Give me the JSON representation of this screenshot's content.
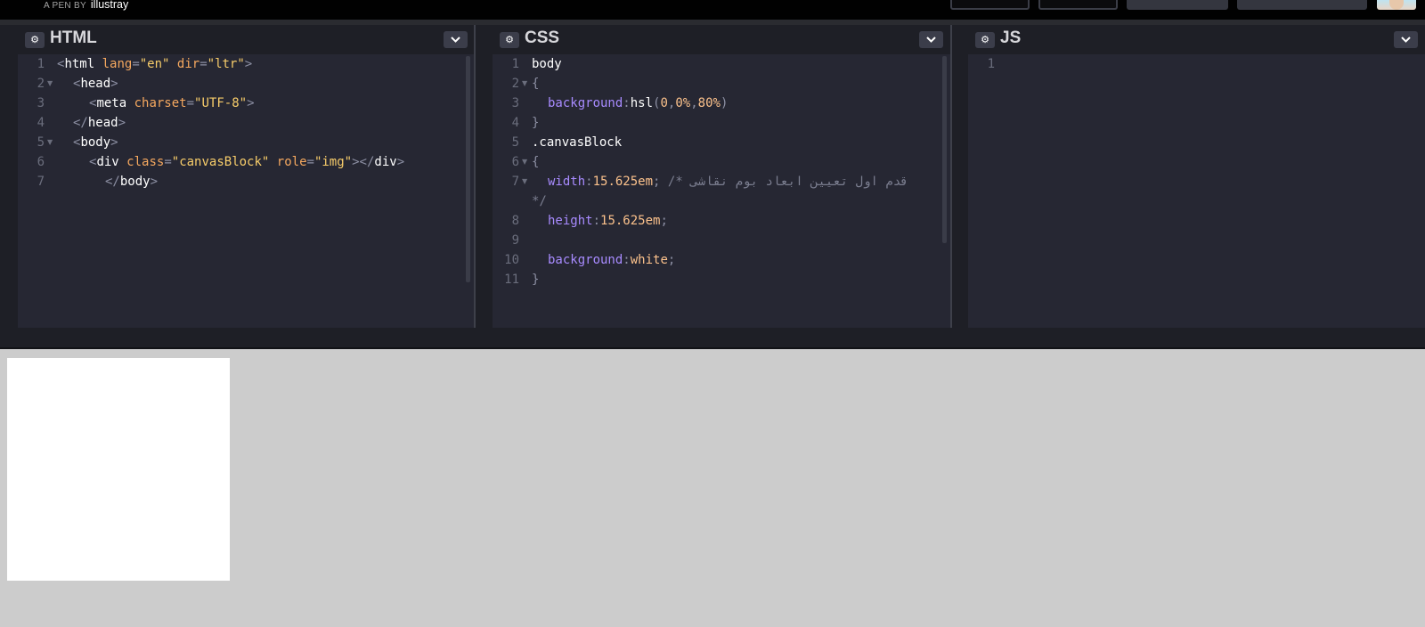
{
  "topbar": {
    "pen_by_prefix": "A PEN BY",
    "author": "illustray"
  },
  "editors": [
    {
      "title": "HTML",
      "lines": [
        {
          "num": "1",
          "fold": false
        },
        {
          "num": "2",
          "fold": true
        },
        {
          "num": "3",
          "fold": false
        },
        {
          "num": "4",
          "fold": false
        },
        {
          "num": "5",
          "fold": true
        },
        {
          "num": "6",
          "fold": false
        },
        {
          "num": "7",
          "fold": false
        }
      ],
      "code": {
        "l1": {
          "lt": "<",
          "tag": "html",
          "attr1": "lang",
          "eq1": "=",
          "val1": "\"en\"",
          "attr2": "dir",
          "eq2": "=",
          "val2": "\"ltr\"",
          "gt": ">"
        },
        "l2": {
          "lt": "<",
          "tag": "head",
          "gt": ">"
        },
        "l3": {
          "lt": "<",
          "tag": "meta",
          "attr": "charset",
          "eq": "=",
          "val": "\"UTF-8\"",
          "gt": ">"
        },
        "l4": {
          "lt": "</",
          "tag": "head",
          "gt": ">"
        },
        "l5": {
          "lt": "<",
          "tag": "body",
          "gt": ">"
        },
        "l6": {
          "lt": "<",
          "tag": "div",
          "attr1": "class",
          "eq1": "=",
          "val1": "\"canvasBlock\"",
          "attr2": "role",
          "eq2": "=",
          "val2": "\"img\"",
          "gt": ">",
          "close_lt": "</",
          "close_tag": "div",
          "close_gt": ">"
        },
        "l7": {
          "lt": "</",
          "tag": "body",
          "gt": ">"
        }
      }
    },
    {
      "title": "CSS",
      "lines": [
        {
          "num": "1",
          "fold": false
        },
        {
          "num": "2",
          "fold": true
        },
        {
          "num": "3",
          "fold": false
        },
        {
          "num": "4",
          "fold": false
        },
        {
          "num": "5",
          "fold": false
        },
        {
          "num": "6",
          "fold": true
        },
        {
          "num": "7",
          "fold": true
        },
        {
          "num": "8",
          "fold": false
        },
        {
          "num": "9",
          "fold": false
        },
        {
          "num": "10",
          "fold": false
        },
        {
          "num": "11",
          "fold": false
        }
      ],
      "code": {
        "l1": "body",
        "l2": "{",
        "l3": {
          "prop": "background",
          "colon": ":",
          "fn": "hsl",
          "open": "(",
          "a": "0",
          "c1": ",",
          "b": "0%",
          "c2": ",",
          "c": "80%",
          "close": ")"
        },
        "l4": "}",
        "l5": ".canvasBlock",
        "l6": "{",
        "l7": {
          "prop": "width",
          "colon": ":",
          "value": "15.625em",
          "semi": ";",
          "comment": "/* قدم اول تعیین ابعاد بوم نقاشی",
          "comment_end": "*/"
        },
        "l8": {
          "prop": "height",
          "colon": ":",
          "value": "15.625em",
          "semi": ";"
        },
        "l10": {
          "prop": "background",
          "colon": ":",
          "value": "white",
          "semi": ";"
        },
        "l11": "}"
      }
    },
    {
      "title": "JS",
      "lines": [
        {
          "num": "1",
          "fold": false
        }
      ]
    }
  ],
  "colors": {
    "editor_bg": "#262733",
    "header_bg": "#1e1f26",
    "preview_bg": "#cccccc",
    "canvas_block": "#ffffff",
    "property": "#a88bff",
    "string": "#f8cd6a",
    "attribute": "#f5a85f"
  },
  "icons": {
    "settings": "gear-icon",
    "collapse": "chevron-down-icon"
  }
}
